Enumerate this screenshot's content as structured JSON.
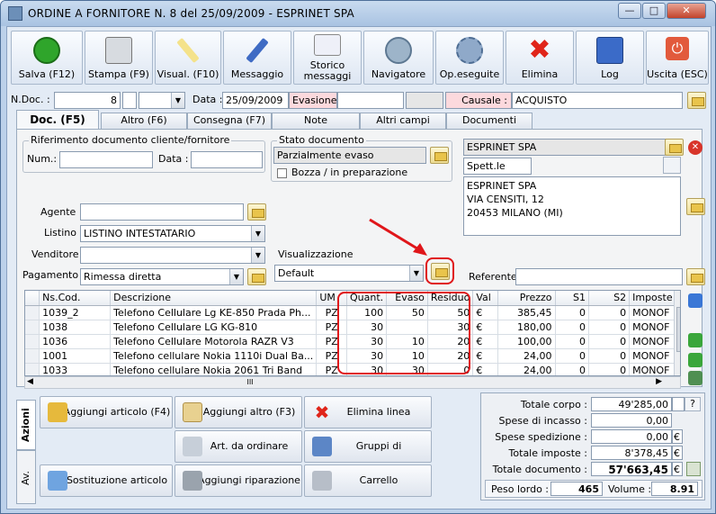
{
  "window": {
    "title": "ORDINE A FORNITORE N. 8  del 25/09/2009 - ESPRINET SPA"
  },
  "colors": {
    "accent_red": "#e0161a",
    "pink_field": "#fcd9dd",
    "title_bg": "#c9dbef"
  },
  "toolbar": [
    {
      "label": "Salva (F12)",
      "icon": "check-icon"
    },
    {
      "label": "Stampa (F9)",
      "icon": "printer-icon"
    },
    {
      "label": "Visual. (F10)",
      "icon": "magic-wand-icon"
    },
    {
      "label": "Messaggio",
      "icon": "pen-icon"
    },
    {
      "label": "Storico messaggi",
      "icon": "envelope-search-icon"
    },
    {
      "label": "Navigatore",
      "icon": "compass-icon"
    },
    {
      "label": "Op.eseguite",
      "icon": "gears-icon"
    },
    {
      "label": "Elimina",
      "icon": "red-x-icon"
    },
    {
      "label": "Log",
      "icon": "book-search-icon"
    },
    {
      "label": "Uscita (ESC)",
      "icon": "power-icon"
    }
  ],
  "header": {
    "ndoc_label": "N.Doc. :",
    "ndoc_value": "8",
    "data_label": "Data :",
    "data_value": "25/09/2009",
    "evasione_label": "Evasione:",
    "evasione_value": "",
    "causale_label": "Causale :",
    "causale_value": "ACQUISTO"
  },
  "tabs": [
    "Doc. (F5)",
    "Altro (F6)",
    "Consegna (F7)",
    "Note",
    "Altri campi",
    "Documenti"
  ],
  "doc": {
    "rif_group": "Riferimento documento cliente/fornitore",
    "num_label": "Num.:",
    "num_value": "",
    "data_label": "Data :",
    "data_value": "",
    "stato_group": "Stato documento",
    "stato_value": "Parzialmente evaso",
    "bozza_label": "Bozza / in preparazione",
    "agente_label": "Agente :",
    "agente_value": "",
    "listino_label": "Listino :",
    "listino_value": "LISTINO INTESTATARIO",
    "venditore_label": "Venditore :",
    "venditore_value": "",
    "pagamento_label": "Pagamento :",
    "pagamento_value": "Rimessa diretta",
    "visual_group": "Visualizzazione",
    "visual_value": "Default",
    "supplier_name": "ESPRINET SPA",
    "supplier_title": "Spett.le",
    "address_lines": [
      "ESPRINET SPA",
      "VIA CENSITI, 12",
      "20453 MILANO (MI)"
    ],
    "referente_label": "Referente",
    "referente_value": ""
  },
  "grid": {
    "columns": [
      "Ns.Cod.",
      "Descrizione",
      "UM",
      "Quant.",
      "Evaso",
      "Residuo",
      "Val",
      "Prezzo",
      "S1",
      "S2",
      "Imposte"
    ],
    "rows": [
      [
        "1039_2",
        "Telefono Cellulare Lg KE-850 Prada Ph...",
        "PZ",
        "100",
        "50",
        "50",
        "€",
        "385,45",
        "0",
        "0",
        "MONOF"
      ],
      [
        "1038",
        "Telefono Cellulare LG KG-810",
        "PZ",
        "30",
        "",
        "30",
        "€",
        "180,00",
        "0",
        "0",
        "MONOF"
      ],
      [
        "1036",
        "Telefono Cellulare Motorola RAZR V3",
        "PZ",
        "30",
        "10",
        "20",
        "€",
        "100,00",
        "0",
        "0",
        "MONOF"
      ],
      [
        "1001",
        "Telefono cellulare Nokia 1110i Dual Ba...",
        "PZ",
        "30",
        "10",
        "20",
        "€",
        "24,00",
        "0",
        "0",
        "MONOF"
      ],
      [
        "1033",
        "Telefono cellulare Nokia 2061 Tri Band",
        "PZ",
        "30",
        "30",
        "0",
        "€",
        "24,00",
        "0",
        "0",
        "MONOF"
      ]
    ],
    "hscroll_glyph": "III"
  },
  "vtabs": [
    "Azioni",
    "Av."
  ],
  "actions": [
    {
      "label": "Aggiungi articolo (F4)",
      "icon": "box-add-icon"
    },
    {
      "label": "Aggiungi altro (F3)",
      "icon": "grid-add-icon"
    },
    {
      "label": "Elimina linea",
      "icon": "red-x-icon"
    },
    {
      "label": "Art. da ordinare",
      "icon": "order-icon"
    },
    {
      "label": "Gruppi di inserimento",
      "icon": "group-add-icon"
    },
    {
      "label": "Sostituzione articolo",
      "icon": "shapes-icon"
    },
    {
      "label": "Aggiungi riparazione",
      "icon": "wrench-icon"
    },
    {
      "label": "Carrello",
      "icon": "cart-icon"
    }
  ],
  "totals": {
    "rows": [
      {
        "label": "Totale corpo :",
        "value": "49'285,00",
        "cur": ""
      },
      {
        "label": "Spese di incasso :",
        "value": "0,00",
        "cur": ""
      },
      {
        "label": "Spese spedizione :",
        "value": "0,00",
        "cur": "€"
      },
      {
        "label": "Totale imposte :",
        "value": "8'378,45",
        "cur": "€"
      },
      {
        "label": "Totale documento :",
        "value": "57'663,45",
        "cur": "€"
      }
    ],
    "help_label": "?",
    "peso_label": "Peso lordo :",
    "peso_value": "465",
    "volume_label": "Volume :",
    "volume_value": "8.91"
  }
}
